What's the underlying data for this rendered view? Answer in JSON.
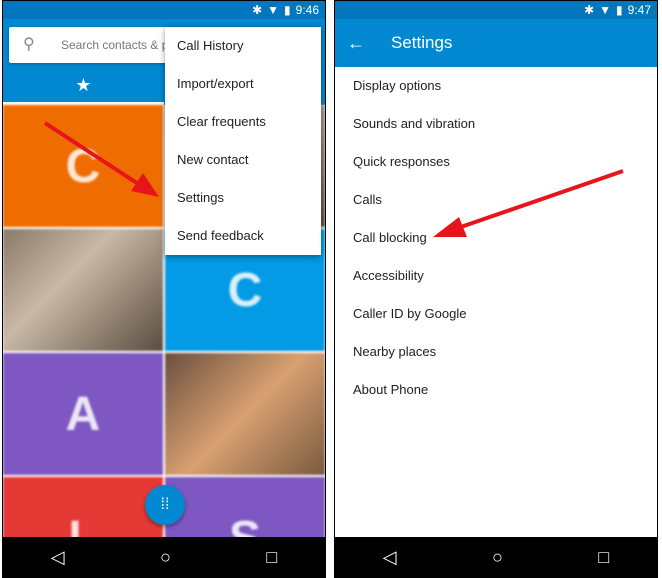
{
  "left": {
    "status": {
      "time": "9:46"
    },
    "search": {
      "placeholder": "Search contacts & places"
    },
    "tabs": [
      {
        "icon": "star-icon"
      },
      {
        "icon": "clock-icon"
      }
    ],
    "tiles": [
      {
        "letter": "C",
        "color": "#ef6c00"
      },
      {
        "letter": "",
        "color": "photo"
      },
      {
        "letter": "",
        "color": "photo"
      },
      {
        "letter": "C",
        "color": "#039be5"
      },
      {
        "letter": "A",
        "color": "#7e57c2"
      },
      {
        "letter": "",
        "color": "photo"
      },
      {
        "letter": "L",
        "color": "#e53935"
      },
      {
        "letter": "S",
        "color": "#7e57c2"
      }
    ],
    "menu": [
      "Call History",
      "Import/export",
      "Clear frequents",
      "New contact",
      "Settings",
      "Send feedback"
    ]
  },
  "right": {
    "status": {
      "time": "9:47"
    },
    "title": "Settings",
    "items": [
      "Display options",
      "Sounds and vibration",
      "Quick responses",
      "Calls",
      "Call blocking",
      "Accessibility",
      "Caller ID by Google",
      "Nearby places",
      "About Phone"
    ]
  },
  "colors": {
    "appbar": "#0288d1",
    "statusbar": "#0277bd",
    "arrow": "#e8141b"
  }
}
